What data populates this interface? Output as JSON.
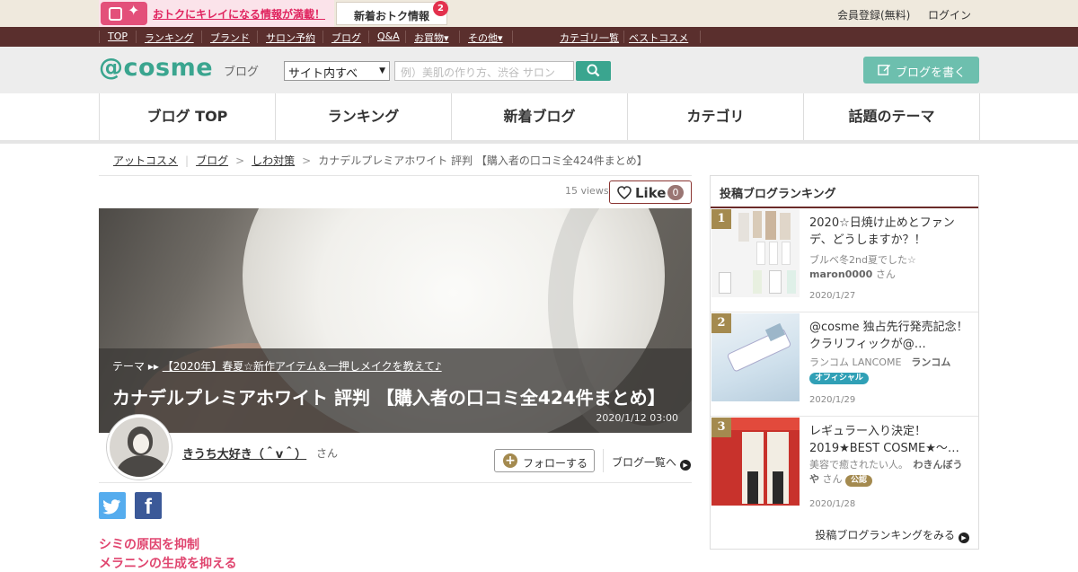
{
  "promo": {
    "text": "おトクにキレイになる情報が満載！",
    "news_label": "新着おトク情報",
    "news_count": "2"
  },
  "account": {
    "register": "会員登録(無料)",
    "login": "ログイン"
  },
  "topnav": {
    "items": [
      "TOP",
      "ランキング",
      "ブランド",
      "サロン予約",
      "ブログ",
      "Q&A",
      "お買物▾",
      "その他▾"
    ],
    "right_items": [
      "カテゴリ一覧",
      "ベストコスメ"
    ]
  },
  "header": {
    "logo": "@cosme",
    "logo_sub": "ブログ",
    "scope": "サイト内すべ",
    "search_placeholder": "例）美肌の作り方、渋谷 サロン",
    "write_button": "ブログを書く"
  },
  "main_nav": [
    "ブログ TOP",
    "ランキング",
    "新着ブログ",
    "カテゴリ",
    "話題のテーマ"
  ],
  "breadcrumb": [
    "アットコスメ",
    "ブログ",
    "しわ対策",
    "カナデルプレミアホワイト 評判 【購入者の口コミ全424件まとめ】"
  ],
  "article": {
    "views": "15 views",
    "like_label": "Like",
    "like_count": "0",
    "theme_label": "テーマ",
    "theme_link": "【2020年】春夏☆新作アイテム＆一押しメイクを教えて♪",
    "title": "カナデルプレミアホワイト 評判 【購入者の口コミ全424件まとめ】",
    "date": "2020/1/12 03:00",
    "author": "きうち大好き（＾v＾）",
    "author_suffix": "さん",
    "follow": "フォローする",
    "blog_list": "ブログ一覧へ",
    "body_lines": [
      "シミの原因を抑制",
      "メラニンの生成を抑える"
    ]
  },
  "ranking": {
    "title": "投稿ブログランキング",
    "more": "投稿ブログランキングをみる",
    "items": [
      {
        "rank": "1",
        "title": "2020☆日焼け止めとファンデ、どうしますか？！",
        "author_desc": "ブルベ冬2nd夏でした☆",
        "author": "maron0000",
        "suffix": "さん",
        "badge": "",
        "date": "2020/1/27"
      },
      {
        "rank": "2",
        "title": "@cosme 独占先行発売記念！クラリフィックが@…",
        "author_desc": "ランコム LANCOME",
        "author": "ランコム",
        "suffix": "",
        "badge": "オフィシャル",
        "date": "2020/1/29"
      },
      {
        "rank": "3",
        "title": "レギュラー入り決定！2019★BEST COSME★～…",
        "author_desc": "美容で癒されたい人。",
        "author": "わきんぼうや",
        "suffix": "さん",
        "badge": "公認",
        "date": "2020/1/28"
      }
    ]
  },
  "colors": {
    "brand_green": "#3aa58f",
    "brand_dark": "#5a2f2d",
    "accent_pink": "#e0245f",
    "gold": "#a48a4f"
  }
}
